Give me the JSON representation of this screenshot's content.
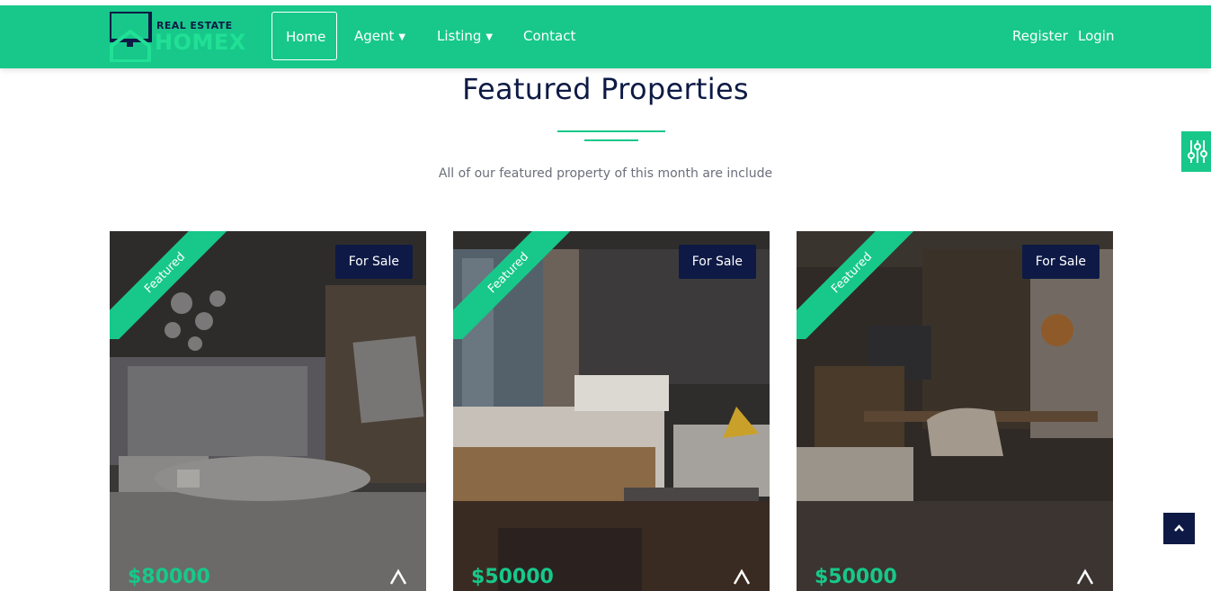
{
  "brand": {
    "small_text": "REAL ESTATE",
    "big_text": "HOMEX",
    "colors": {
      "accent": "#17c88a",
      "navy": "#0e1a45",
      "logo_green": "#21e096"
    }
  },
  "nav": {
    "items": [
      {
        "label": "Home",
        "active": true
      },
      {
        "label": "Agent",
        "dropdown": true,
        "icon": "chevron-down-icon"
      },
      {
        "label": "Listing",
        "dropdown": true,
        "icon": "chevron-down-icon"
      },
      {
        "label": "Contact"
      }
    ],
    "register_label": "Register",
    "login_label": "Login"
  },
  "section": {
    "title": "Featured Properties",
    "subtitle": "All of our featured property of this month are include"
  },
  "cards": [
    {
      "ribbon": "Featured",
      "badge": "For Sale",
      "price": "$80000",
      "image": "bedroom-chandelier"
    },
    {
      "ribbon": "Featured",
      "badge": "For Sale",
      "price": "$50000",
      "image": "hotel-room-window"
    },
    {
      "ribbon": "Featured",
      "badge": "For Sale",
      "price": "$50000",
      "image": "bedroom-desk"
    }
  ],
  "floating": {
    "settings_icon": "sliders-icon",
    "scroll_top_icon": "chevron-up-icon"
  }
}
